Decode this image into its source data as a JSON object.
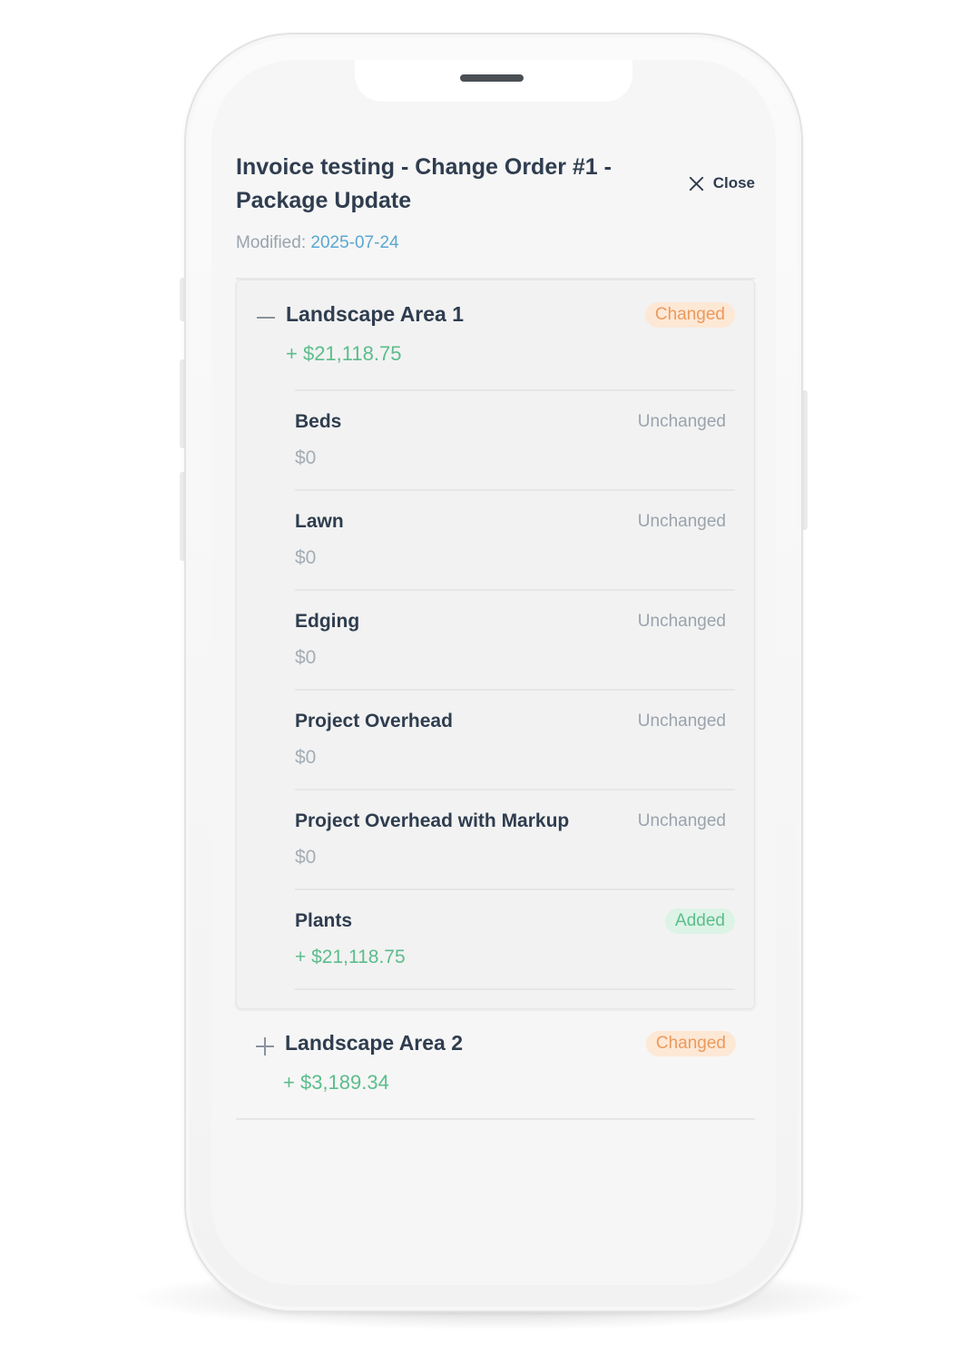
{
  "header": {
    "title": "Invoice testing - Change Order #1 - Package Update",
    "close_label": "Close",
    "modified_label": "Modified:",
    "modified_date": "2025-07-24"
  },
  "areas": [
    {
      "name": "Landscape Area 1",
      "amount": "+ $21,118.75",
      "status": "Changed",
      "expanded": true,
      "toggle_icon": "minus-icon",
      "items": [
        {
          "name": "Beds",
          "amount": "$0",
          "status": "Unchanged"
        },
        {
          "name": "Lawn",
          "amount": "$0",
          "status": "Unchanged"
        },
        {
          "name": "Edging",
          "amount": "$0",
          "status": "Unchanged"
        },
        {
          "name": "Project Overhead",
          "amount": "$0",
          "status": "Unchanged"
        },
        {
          "name": "Project Overhead with Markup",
          "amount": "$0",
          "status": "Unchanged"
        },
        {
          "name": "Plants",
          "amount": "+ $21,118.75",
          "status": "Added"
        }
      ]
    },
    {
      "name": "Landscape Area 2",
      "amount": "+ $3,189.34",
      "status": "Changed",
      "expanded": false,
      "toggle_icon": "plus-icon"
    }
  ],
  "colors": {
    "text_primary": "#2f3d4f",
    "positive_green": "#5cbd8c",
    "changed_orange": "#ec9a5c",
    "date_blue": "#5aa7d1",
    "muted_gray": "#9aa3ad"
  }
}
